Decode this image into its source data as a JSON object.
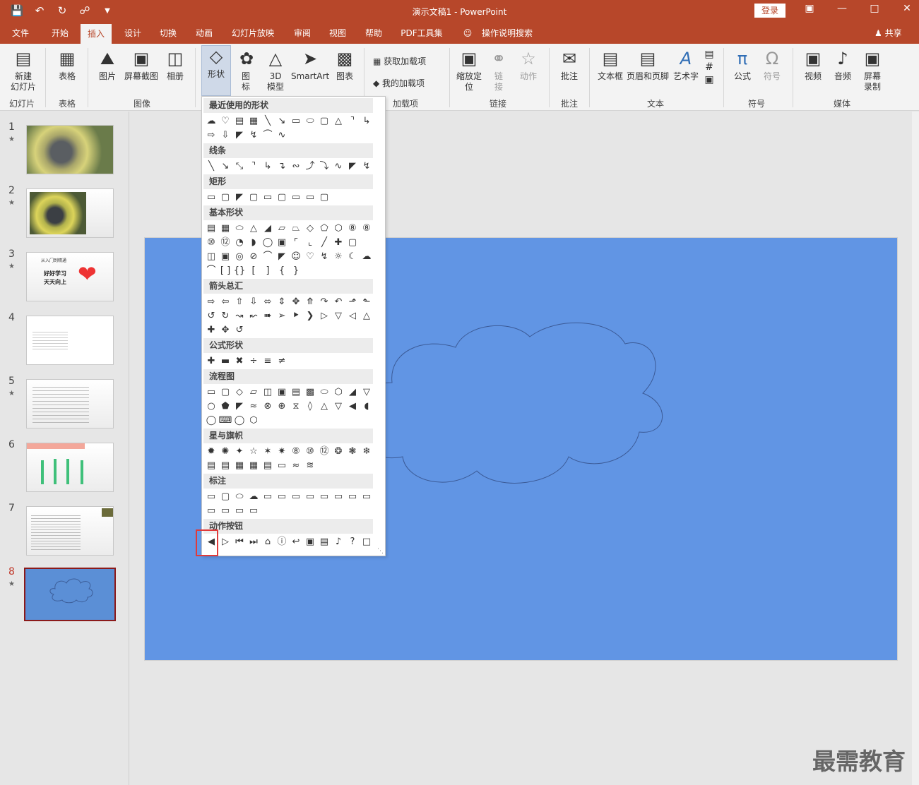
{
  "window": {
    "quick_access_icons": [
      "save-icon",
      "undo-icon",
      "redo-icon",
      "touch-mode-icon",
      "customize-icon"
    ],
    "title": "演示文稿1  -  PowerPoint",
    "login_label": "登录",
    "share_label": "共享"
  },
  "tabs": [
    "文件",
    "开始",
    "插入",
    "设计",
    "切换",
    "动画",
    "幻灯片放映",
    "审阅",
    "视图",
    "帮助",
    "PDF工具集",
    "操作说明搜索"
  ],
  "active_tab": "插入",
  "ribbon": {
    "new_slide_1": "新建",
    "new_slide_2": "幻灯片",
    "table": "表格",
    "picture": "图片",
    "screenshot": "屏幕截图",
    "album": "相册",
    "shapes": "形状",
    "icons_1": "图",
    "icons_2": "标",
    "model_1": "3D",
    "model_2": "模型",
    "smartart": "SmartArt",
    "chart": "图表",
    "get_addins": "获取加载项",
    "my_addins": "我的加载项",
    "zoom_1": "缩放定",
    "zoom_2": "位",
    "link_1": "链",
    "link_2": "接",
    "action": "动作",
    "comment": "批注",
    "textbox": "文本框",
    "header_footer": "页眉和页脚",
    "wordart": "艺术字",
    "equation": "公式",
    "symbol": "符号",
    "video": "视频",
    "audio": "音频",
    "screen_rec_1": "屏幕",
    "screen_rec_2": "录制",
    "groups": {
      "slides": "幻灯片",
      "tables": "表格",
      "images": "图像",
      "addins": "加载项",
      "links": "链接",
      "comments": "批注",
      "text": "文本",
      "symbols": "符号",
      "media": "媒体"
    }
  },
  "gallery": {
    "categories": [
      "最近使用的形状",
      "线条",
      "矩形",
      "基本形状",
      "箭头总汇",
      "公式形状",
      "流程图",
      "星与旗帜",
      "标注",
      "动作按钮"
    ]
  },
  "thumbnails": {
    "numbers": [
      "1",
      "2",
      "3",
      "4",
      "5",
      "6",
      "7",
      "8"
    ],
    "slide3_line1": "从入门到精通",
    "slide3_line2": "好好学习",
    "slide3_line3": "天天向上",
    "selected": "8"
  },
  "watermark": "最需教育"
}
